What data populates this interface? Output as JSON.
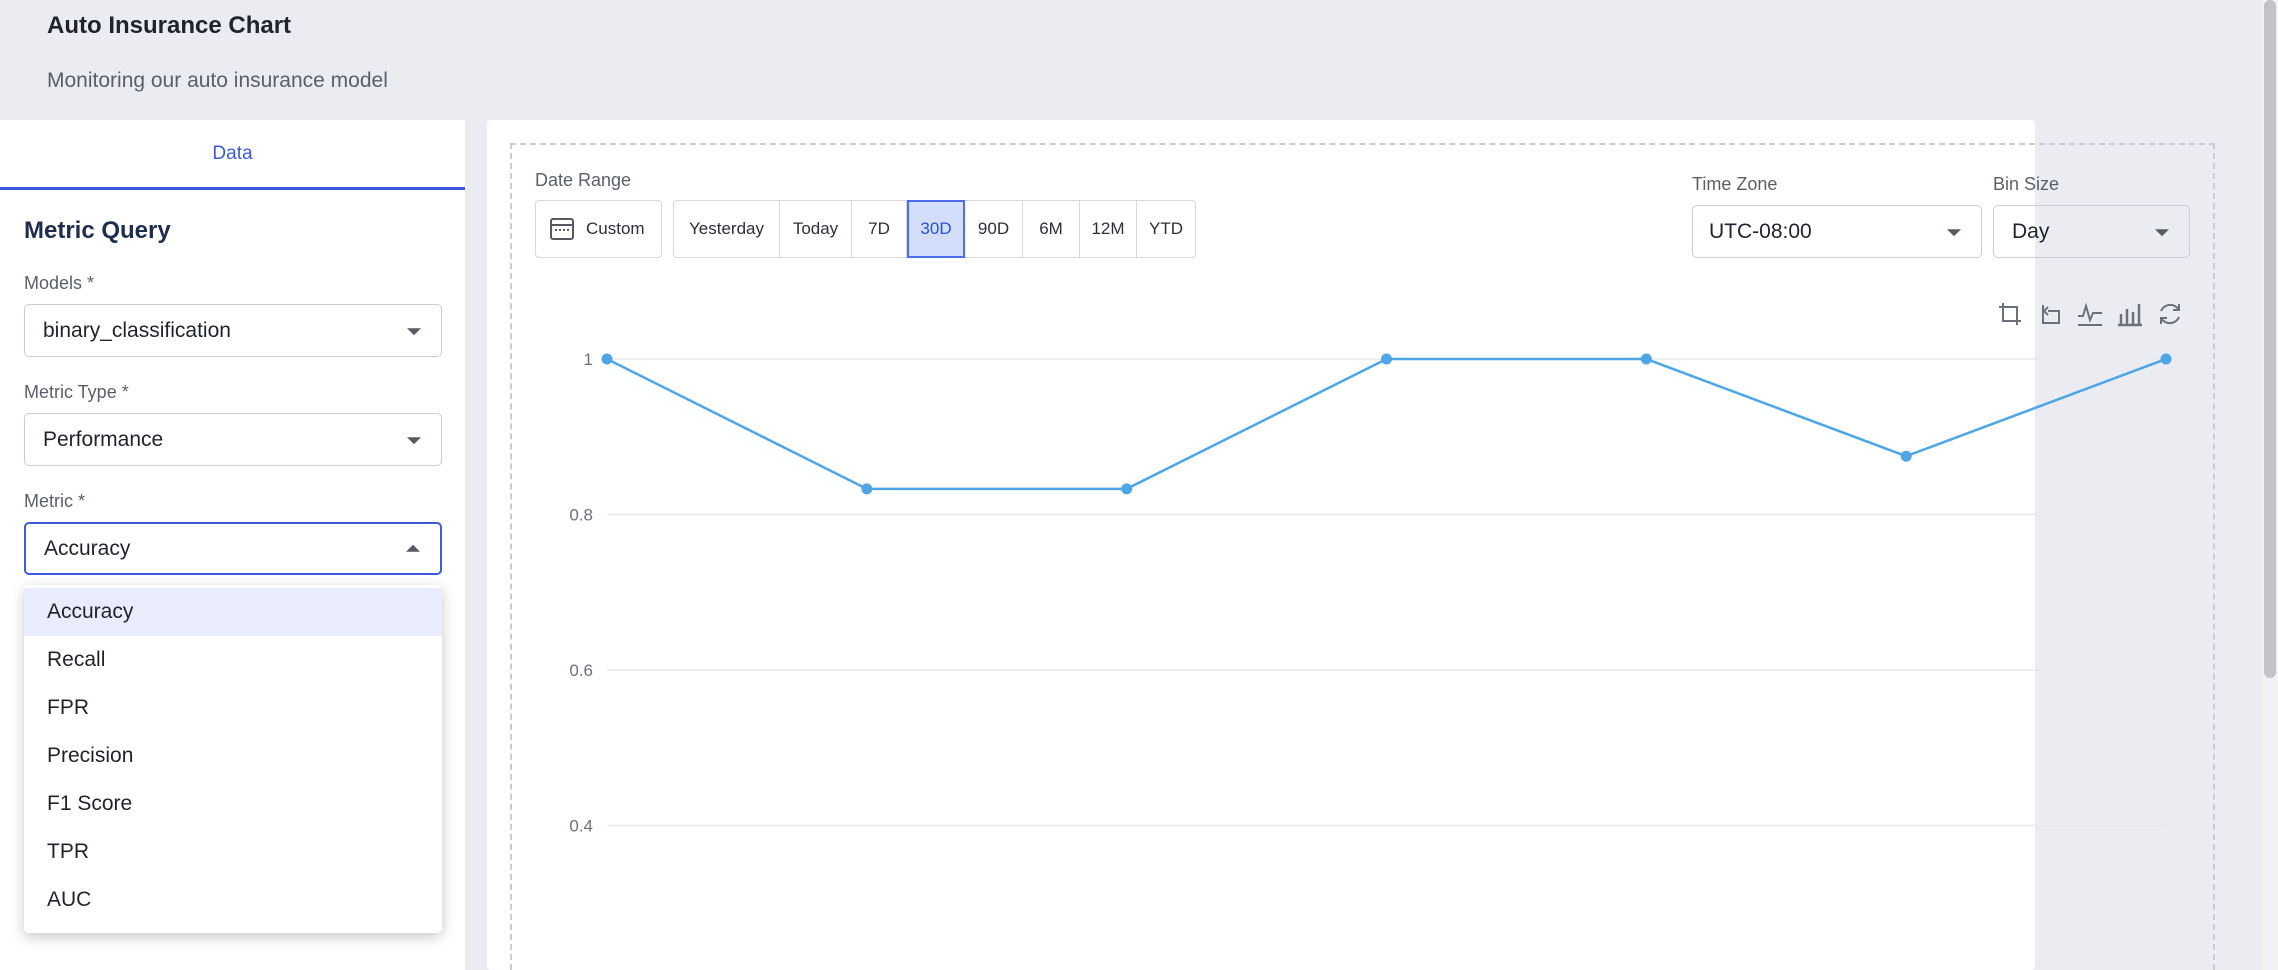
{
  "header": {
    "title": "Auto Insurance Chart",
    "subtitle": "Monitoring our auto insurance model"
  },
  "left_panel": {
    "tab_label": "Data",
    "section_title": "Metric Query",
    "models_label": "Models *",
    "models_value": "binary_classification",
    "metric_type_label": "Metric Type *",
    "metric_type_value": "Performance",
    "metric_label": "Metric *",
    "metric_value": "Accuracy",
    "metric_options": [
      "Accuracy",
      "Recall",
      "FPR",
      "Precision",
      "F1 Score",
      "TPR",
      "AUC"
    ],
    "metric_options_active": "Accuracy"
  },
  "controls": {
    "date_range_label": "Date Range",
    "custom_label": "Custom",
    "ranges": [
      "Yesterday",
      "Today",
      "7D",
      "30D",
      "90D",
      "6M",
      "12M",
      "YTD"
    ],
    "selected_range": "30D",
    "time_zone_label": "Time Zone",
    "time_zone_value": "UTC-08:00",
    "bin_size_label": "Bin Size",
    "bin_size_value": "Day"
  },
  "toolbar_icons": [
    "zoom-crop-icon",
    "zoom-reset-icon",
    "line-chart-icon",
    "bar-chart-icon",
    "refresh-icon"
  ],
  "colors": {
    "accent": "#3b5bdb",
    "series": "#4ea6e6",
    "selected_bg": "#d3defb"
  },
  "chart_data": {
    "type": "line",
    "title": "",
    "xlabel": "",
    "ylabel": "",
    "x": [
      0,
      1,
      2,
      3,
      4,
      5,
      6
    ],
    "y": [
      1.0,
      0.833,
      0.833,
      1.0,
      1.0,
      0.875,
      1.0
    ],
    "yticks": [
      "1",
      "0.8",
      "0.6",
      "0.4"
    ],
    "ylim": [
      0.4,
      1.0
    ],
    "grid": true,
    "legend": "none"
  }
}
